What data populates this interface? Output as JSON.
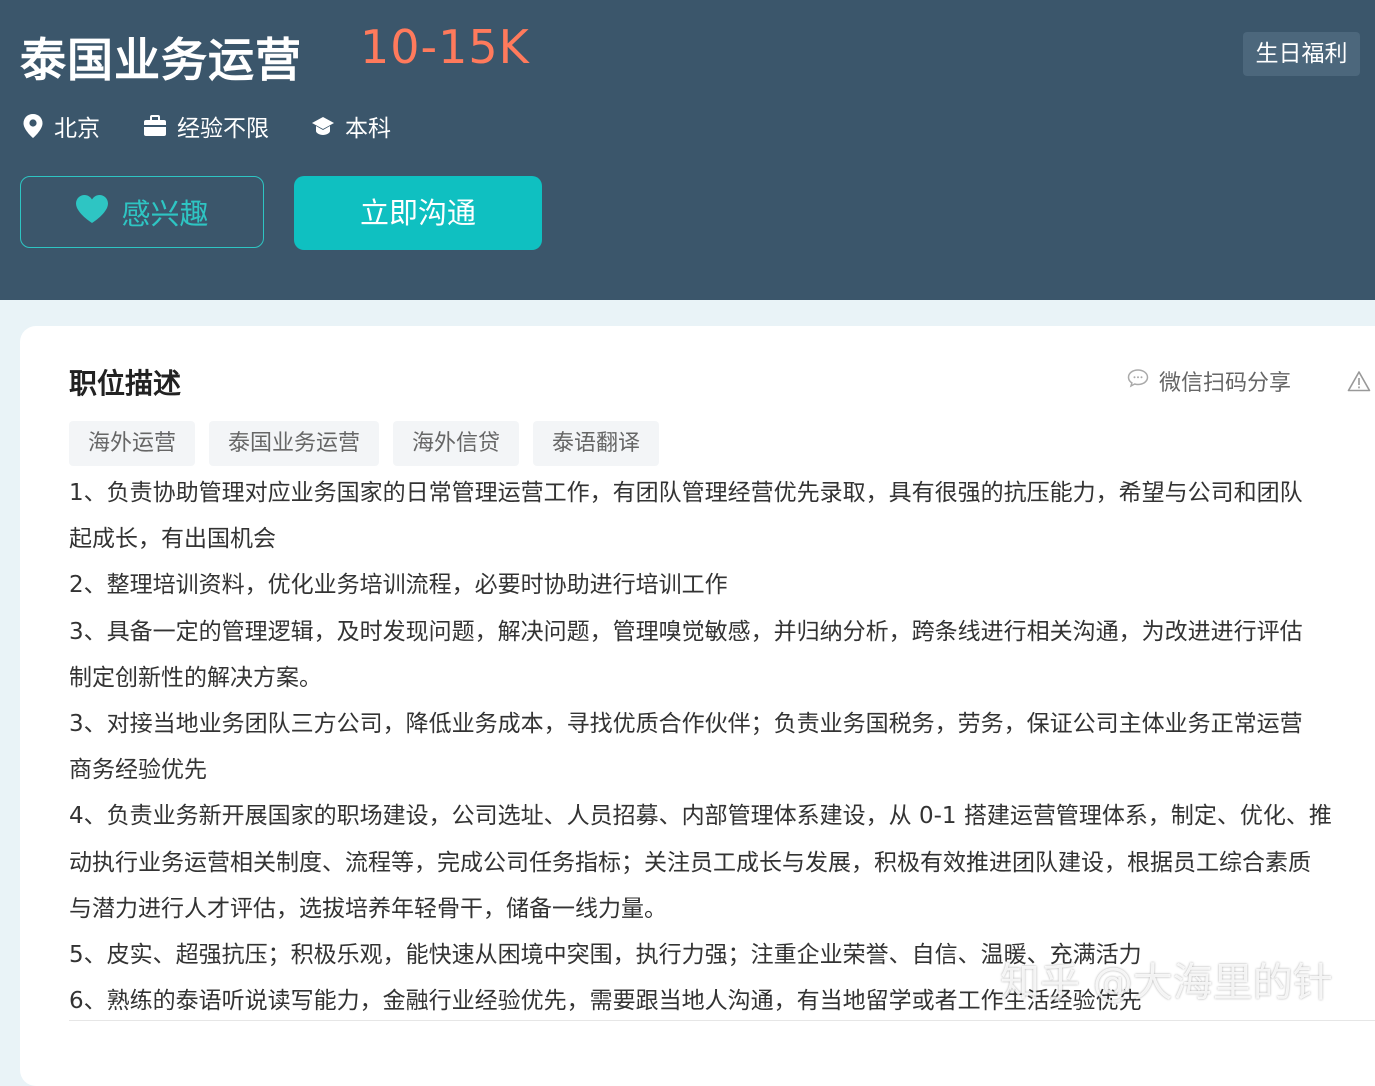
{
  "job": {
    "title": "泰国业务运营",
    "salary": "10-15K",
    "benefit_tag": "生日福利",
    "location": "北京",
    "experience": "经验不限",
    "education": "本科"
  },
  "actions": {
    "interest_label": "感兴趣",
    "chat_label": "立即沟通"
  },
  "description": {
    "section_title": "职位描述",
    "share_label": "微信扫码分享",
    "tags": [
      "海外运营",
      "泰国业务运营",
      "海外信贷",
      "泰语翻译"
    ],
    "lines": [
      "1、负责协助管理对应业务国家的日常管理运营工作，有团队管理经营优先录取，具有很强的抗压能力，希望与公司和团队",
      "起成长，有出国机会",
      "2、整理培训资料，优化业务培训流程，必要时协助进行培训工作",
      "3、具备一定的管理逻辑，及时发现问题，解决问题，管理嗅觉敏感，并归纳分析，跨条线进行相关沟通，为改进进行评估",
      "制定创新性的解决方案。",
      "3、对接当地业务团队三方公司，降低业务成本，寻找优质合作伙伴；负责业务国税务，劳务，保证公司主体业务正常运营",
      "商务经验优先",
      "4、负责业务新开展国家的职场建设，公司选址、人员招募、内部管理体系建设，从 0-1 搭建运营管理体系，制定、优化、推",
      "动执行业务运营相关制度、流程等，完成公司任务指标；关注员工成长与发展，积极有效推进团队建设，根据员工综合素质",
      "与潜力进行人才评估，选拔培养年轻骨干，储备一线力量。",
      "5、皮实、超强抗压；积极乐观，能快速从困境中突围，执行力强；注重企业荣誉、自信、温暖、充满活力",
      "6、熟练的泰语听说读写能力，金融行业经验优先，需要跟当地人沟通，有当地留学或者工作生活经验优先"
    ]
  },
  "watermark": "知乎 @大海里的针",
  "colors": {
    "header_bg": "#3b566b",
    "salary": "#ff7a5c",
    "accent": "#0fc0c1",
    "page_bg": "#e9f3f7"
  }
}
